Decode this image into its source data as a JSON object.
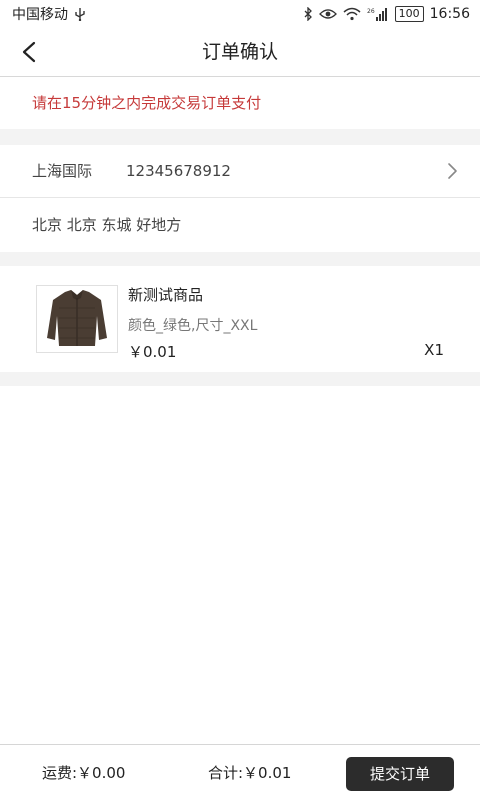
{
  "status_bar": {
    "carrier": "中国移动",
    "usb_icon": "usb-icon",
    "network": "26",
    "battery": "100",
    "time": "16:56"
  },
  "header": {
    "title": "订单确认",
    "back_icon": "back-arrow-icon"
  },
  "notice": {
    "text": "请在15分钟之内完成交易订单支付",
    "color": "#c63a3a"
  },
  "address": {
    "name": "上海国际",
    "phone": "12345678912",
    "detail": "北京 北京 东城 好地方",
    "chevron_icon": "chevron-right-icon"
  },
  "product": {
    "name": "新测试商品",
    "spec": "颜色_绿色,尺寸_XXL",
    "price": "￥0.01",
    "quantity": "X1",
    "image_icon": "jacket-image"
  },
  "footer": {
    "freight": "运费:￥0.00",
    "total": "合计:￥0.01",
    "submit_label": "提交订单",
    "submit_color": "#2c2c2c"
  }
}
